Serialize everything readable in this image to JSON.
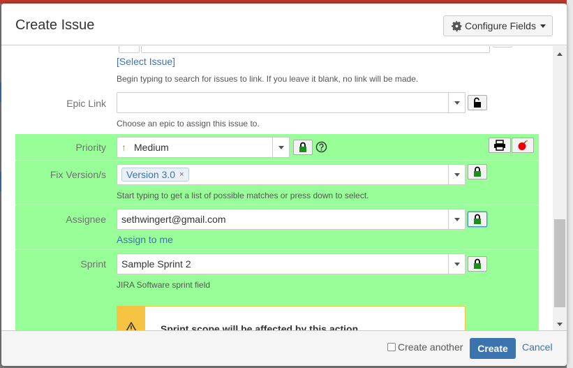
{
  "dialog": {
    "title": "Create Issue",
    "configure_label": "Configure Fields"
  },
  "linked_issue": {
    "select_link": "[Select Issue]",
    "help": "Begin typing to search for issues to link. If you leave it blank, no link will be made."
  },
  "epic_link": {
    "label": "Epic Link",
    "value": "",
    "help": "Choose an epic to assign this issue to."
  },
  "priority": {
    "label": "Priority",
    "value": "Medium",
    "arrow_glyph": "↑"
  },
  "fix_version": {
    "label": "Fix Version/s",
    "tag": "Version 3.0",
    "remove_glyph": "×",
    "help": "Start typing to get a list of possible matches or press down to select."
  },
  "assignee": {
    "label": "Assignee",
    "value": "sethwingert@gmail.com",
    "assign_to_me": "Assign to me"
  },
  "sprint": {
    "label": "Sprint",
    "value": "Sample Sprint 2",
    "help": "JIRA Software sprint field"
  },
  "warning": {
    "message": "Sprint scope will be affected by this action."
  },
  "footer": {
    "create_another": "Create another",
    "create": "Create",
    "cancel": "Cancel"
  },
  "colors": {
    "highlight": "#98ff98",
    "primary": "#3b73af",
    "warning": "#f6c342",
    "lock_green": "#1a8f1a"
  },
  "icons": {
    "configure": "gear-icon",
    "lock": "lock-icon",
    "unlock": "unlock-icon",
    "help": "help-icon",
    "print": "printer-icon",
    "bomb": "bomb-icon",
    "warning": "warning-icon"
  }
}
